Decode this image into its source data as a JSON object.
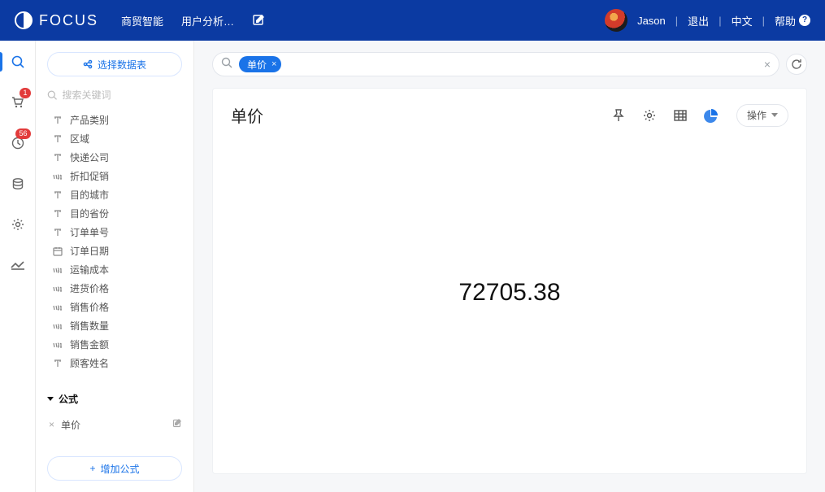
{
  "brand": {
    "name": "FOCUS"
  },
  "topnav": {
    "item_bi": "商贸智能",
    "item_user_analysis": "用户分析…"
  },
  "topright": {
    "username": "Jason",
    "logout": "退出",
    "lang": "中文",
    "help": "帮助"
  },
  "rail": {
    "badge_cart": "1",
    "badge_clock": "56"
  },
  "sidebar": {
    "select_ds": "选择数据表",
    "search_placeholder": "搜索关键词",
    "fields": [
      {
        "type": "text",
        "label": "产品类别"
      },
      {
        "type": "text",
        "label": "区域"
      },
      {
        "type": "text",
        "label": "快递公司"
      },
      {
        "type": "number",
        "label": "折扣促销"
      },
      {
        "type": "text",
        "label": "目的城市"
      },
      {
        "type": "text",
        "label": "目的省份"
      },
      {
        "type": "text",
        "label": "订单单号"
      },
      {
        "type": "date",
        "label": "订单日期"
      },
      {
        "type": "number",
        "label": "运输成本"
      },
      {
        "type": "number",
        "label": "进货价格"
      },
      {
        "type": "number",
        "label": "销售价格"
      },
      {
        "type": "number",
        "label": "销售数量"
      },
      {
        "type": "number",
        "label": "销售金额"
      },
      {
        "type": "text",
        "label": "顾客姓名"
      }
    ],
    "formula_header": "公式",
    "formula_item": "单价",
    "add_formula": "增加公式"
  },
  "query": {
    "pill_label": "单价"
  },
  "card": {
    "title": "单价",
    "op_label": "操作"
  },
  "chart_data": {
    "type": "table",
    "title": "单价",
    "value": 72705.38,
    "value_display": "72705.38"
  }
}
